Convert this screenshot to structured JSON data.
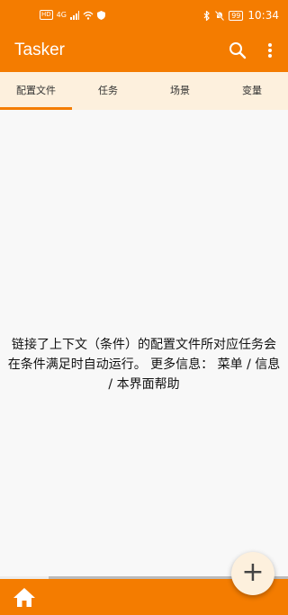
{
  "status_bar": {
    "hd": "HD",
    "signal": "4G",
    "battery": "99",
    "time": "10:34"
  },
  "app_bar": {
    "title": "Tasker"
  },
  "tabs": [
    {
      "label": "配置文件",
      "active": true
    },
    {
      "label": "任务",
      "active": false
    },
    {
      "label": "场景",
      "active": false
    },
    {
      "label": "变量",
      "active": false
    }
  ],
  "main": {
    "empty_message": "链接了上下文（条件）的配置文件所对应任务会在条件满足时自动运行。 更多信息： 菜单 / 信息 / 本界面帮助"
  },
  "fab": {
    "label": "+"
  },
  "progress": {
    "fraction": 0.17
  },
  "colors": {
    "accent": "#f47c00",
    "tab_background": "#fdf0dd"
  }
}
